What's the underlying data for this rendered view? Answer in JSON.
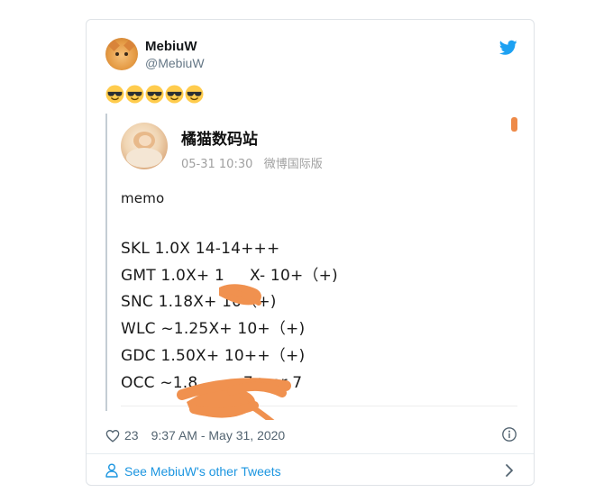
{
  "tweet": {
    "author_name": "MebiuW",
    "author_handle": "@MebiuW",
    "text_emoji": "😎😎😎😎😎",
    "likes": "23",
    "timestamp": "9:37 AM - May 31, 2020",
    "more_tweets_link": "See MebiuW's other Tweets"
  },
  "quoted": {
    "author_name": "橘猫数码站",
    "meta": "05-31 10:30   微博国际版",
    "lines": [
      "memo",
      "SKL 1.0X 14-14+++",
      "GMT 1.0X+ 1     X- 10+（+)",
      "SNC 1.18X+ 10（+)",
      "WLC ~1.25X+ 10+（+)",
      "GDC 1.50X+ 10++（+)",
      "OCC ~1.8         7+ or 7"
    ]
  },
  "colors": {
    "accent": "#1da1f2",
    "link": "#1b95e0",
    "redaction": "#f0914f",
    "muted": "#536471"
  },
  "icons": {
    "brand": "twitter-bird-icon",
    "like": "heart-icon",
    "info": "info-icon",
    "person": "person-icon",
    "navigate": "chevron-right-icon"
  }
}
